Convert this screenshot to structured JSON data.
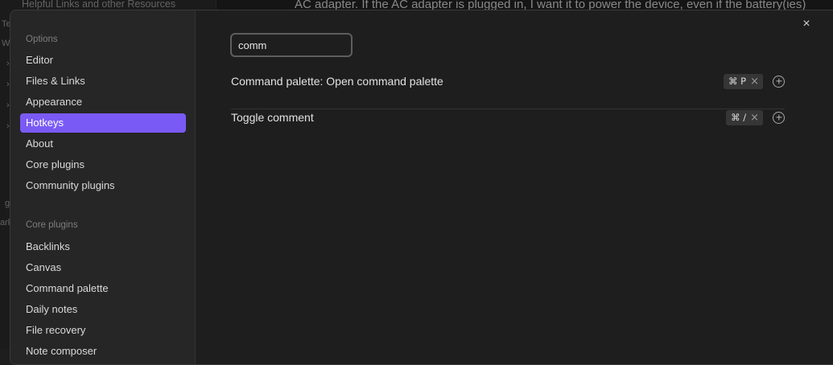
{
  "background": {
    "sidebar_title": "Helpful Links and other Resources",
    "fragments": [
      "Te",
      "W",
      "›",
      "›",
      "›",
      "›",
      "g",
      "ark"
    ],
    "note_text": "AC adapter. If the AC adapter is plugged in, I want it to power the device, even if the battery(ies)"
  },
  "settings": {
    "close_label": "×",
    "sidebar": {
      "options_title": "Options",
      "options": [
        "Editor",
        "Files & Links",
        "Appearance",
        "Hotkeys",
        "About",
        "Core plugins",
        "Community plugins"
      ],
      "active_option": "Hotkeys",
      "core_title": "Core plugins",
      "core_plugins": [
        "Backlinks",
        "Canvas",
        "Command palette",
        "Daily notes",
        "File recovery",
        "Note composer"
      ]
    },
    "search": {
      "value": "comm"
    },
    "hotkeys": [
      {
        "name": "Command palette: Open command palette",
        "key": "⌘ P",
        "remove": "×"
      },
      {
        "name": "Toggle comment",
        "key": "⌘ /",
        "remove": "×"
      }
    ]
  }
}
